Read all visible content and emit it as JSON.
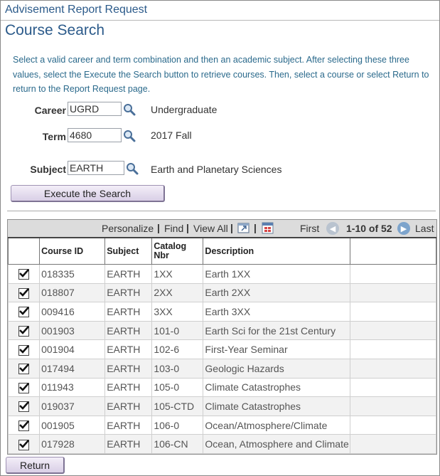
{
  "report_title": "Advisement Report Request",
  "page_title": "Course Search",
  "instructions": "Select a valid career and term combination and then an academic subject. After selecting these three values, select the Execute the Search button to retrieve courses. Then, select a course or select Return to return to the Report Request page.",
  "form": {
    "career": {
      "label": "Career",
      "value": "UGRD",
      "description": "Undergraduate"
    },
    "term": {
      "label": "Term",
      "value": "4680",
      "description": "2017 Fall"
    },
    "subject": {
      "label": "Subject",
      "value": "EARTH",
      "description": "Earth and Planetary Sciences"
    }
  },
  "execute_button": "Execute the Search",
  "toolbar": {
    "personalize": "Personalize",
    "find": "Find",
    "view_all": "View All",
    "first": "First",
    "range": "1-10 of 52",
    "last": "Last"
  },
  "columns": [
    "Course ID",
    "Subject",
    "Catalog Nbr",
    "Description"
  ],
  "rows": [
    {
      "checked": true,
      "course_id": "018335",
      "subject": "EARTH",
      "catalog": "1XX",
      "description": "Earth 1XX"
    },
    {
      "checked": true,
      "course_id": "018807",
      "subject": "EARTH",
      "catalog": "2XX",
      "description": "Earth 2XX"
    },
    {
      "checked": true,
      "course_id": "009416",
      "subject": "EARTH",
      "catalog": "3XX",
      "description": "Earth 3XX"
    },
    {
      "checked": true,
      "course_id": "001903",
      "subject": "EARTH",
      "catalog": "101-0",
      "description": "Earth Sci for the 21st Century"
    },
    {
      "checked": true,
      "course_id": "001904",
      "subject": "EARTH",
      "catalog": "102-6",
      "description": "First-Year Seminar"
    },
    {
      "checked": true,
      "course_id": "017494",
      "subject": "EARTH",
      "catalog": "103-0",
      "description": "Geologic Hazards"
    },
    {
      "checked": true,
      "course_id": "011943",
      "subject": "EARTH",
      "catalog": "105-0",
      "description": "Climate Catastrophes"
    },
    {
      "checked": true,
      "course_id": "019037",
      "subject": "EARTH",
      "catalog": "105-CTD",
      "description": "Climate Catastrophes"
    },
    {
      "checked": true,
      "course_id": "001905",
      "subject": "EARTH",
      "catalog": "106-0",
      "description": "Ocean/Atmosphere/Climate"
    },
    {
      "checked": true,
      "course_id": "017928",
      "subject": "EARTH",
      "catalog": "106-CN",
      "description": "Ocean, Atmosphere and Climate"
    }
  ],
  "return_button": "Return",
  "colors": {
    "title": "#2b5a8a",
    "instructions": "#2b6a8c",
    "button": "#d9cfe6",
    "toolbar": "#dcdcdc"
  }
}
